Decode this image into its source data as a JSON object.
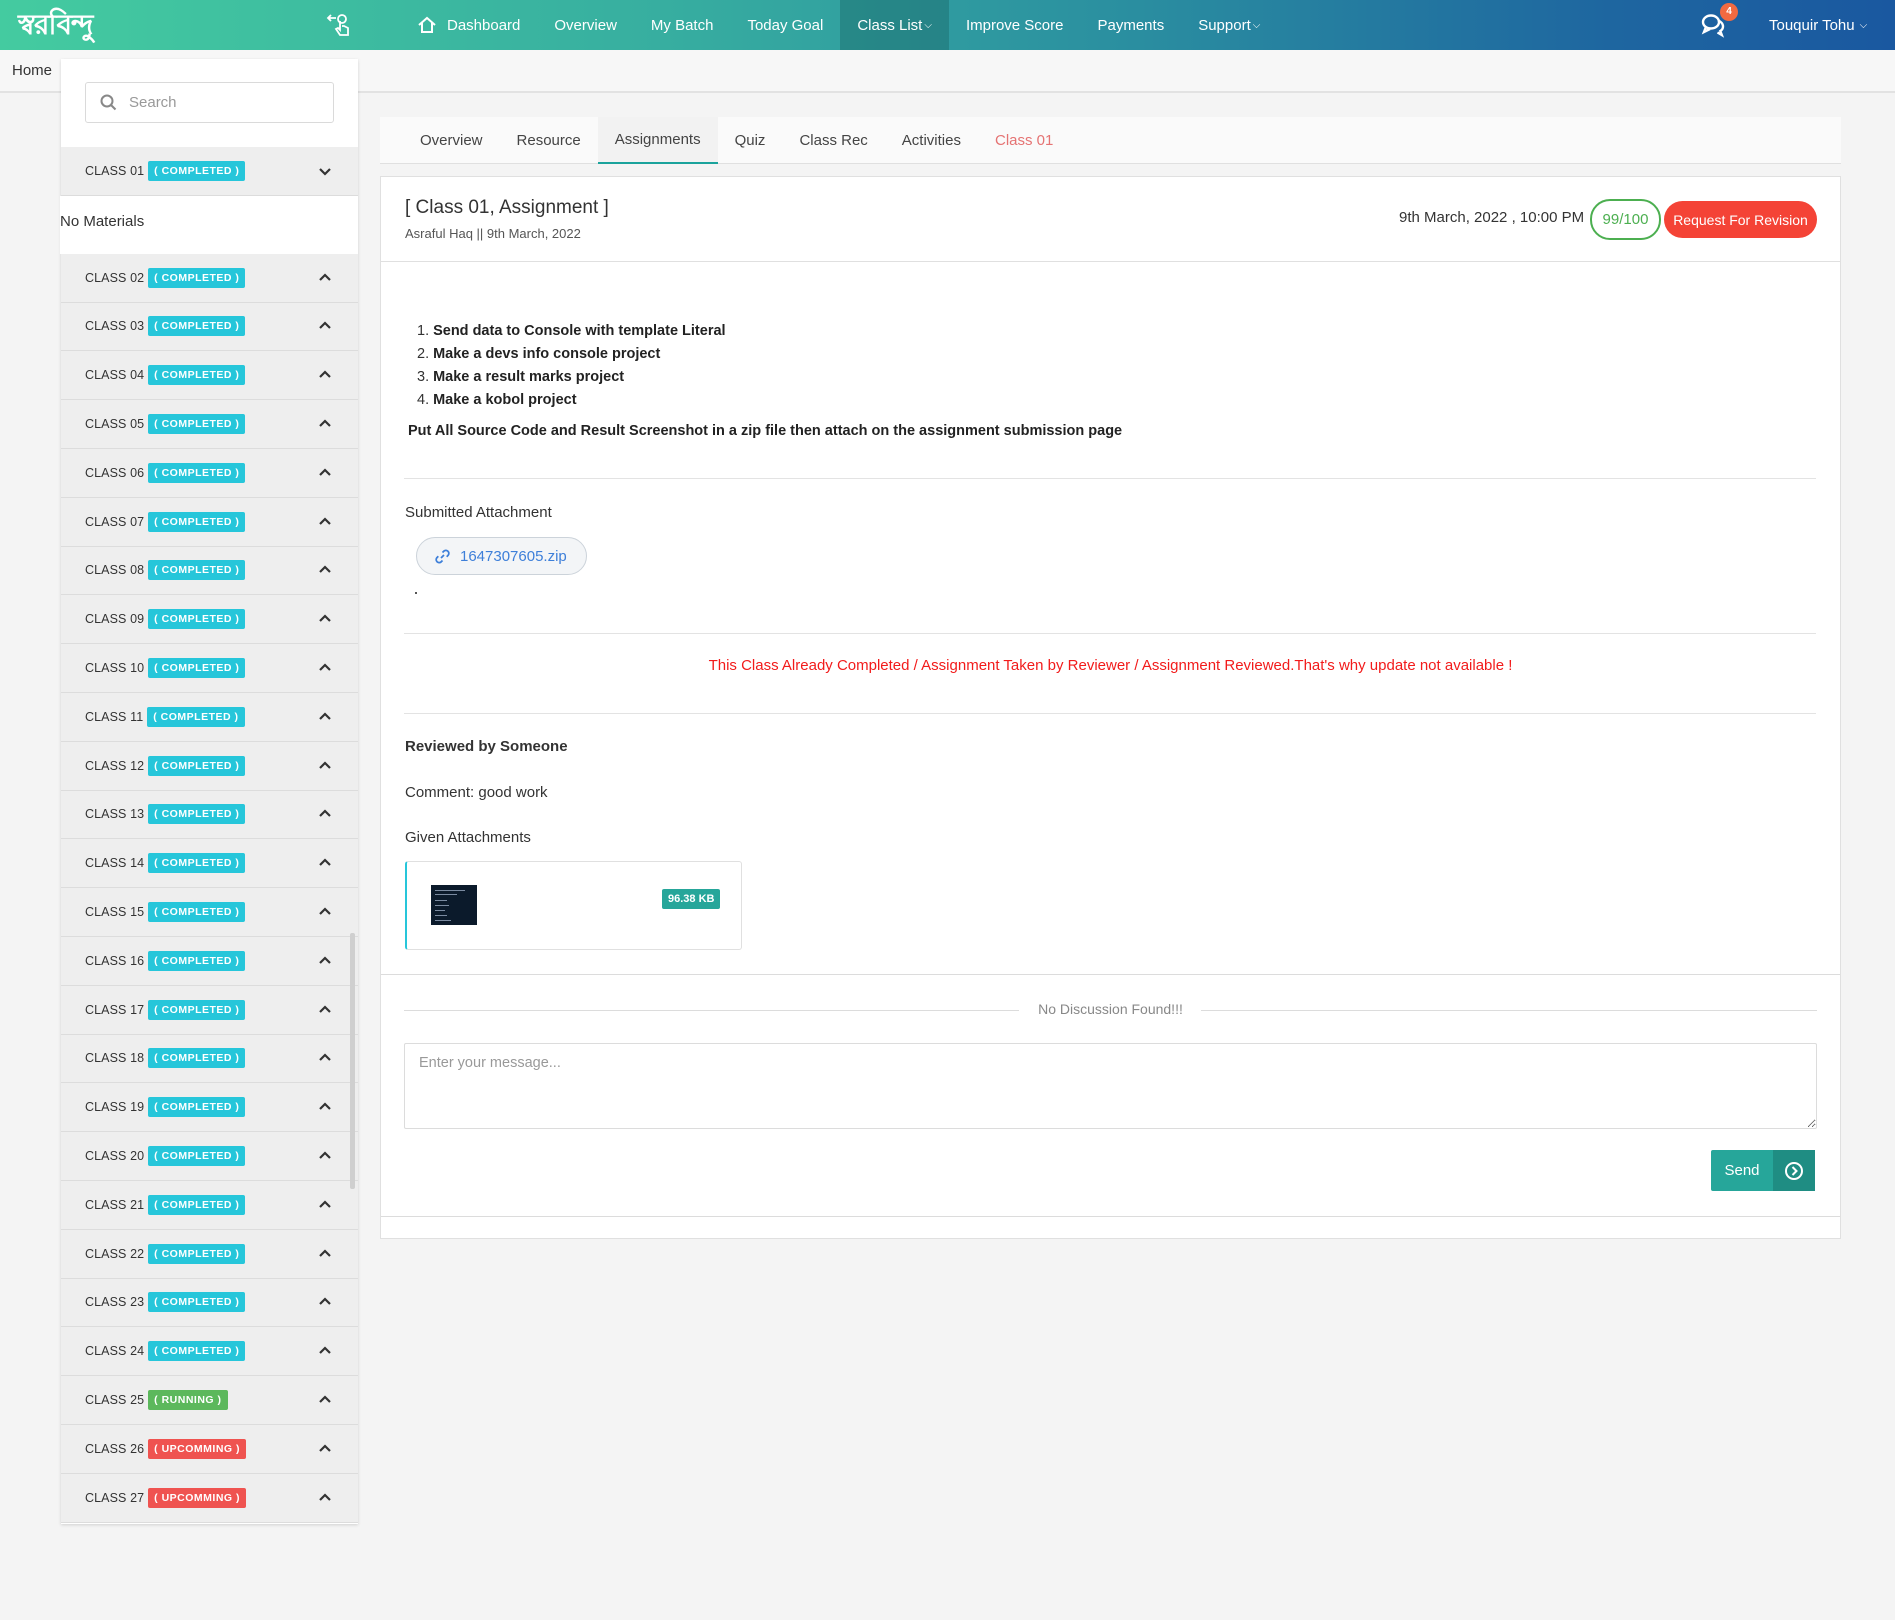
{
  "brand": {
    "logo_text": "স্বরবিন্দু"
  },
  "nav": {
    "items": [
      {
        "label": "Dashboard",
        "icon": "home-icon"
      },
      {
        "label": "Overview"
      },
      {
        "label": "My Batch"
      },
      {
        "label": "Today Goal"
      },
      {
        "label": "Class List",
        "dropdown": true,
        "active": true
      },
      {
        "label": "Improve Score"
      },
      {
        "label": "Payments"
      },
      {
        "label": "Support",
        "dropdown": true
      }
    ],
    "chevron": "⌄",
    "notifications": {
      "icon": "chat-icon",
      "count": "4"
    },
    "user": {
      "name": "Touquir Tohu",
      "chevron": "⌄"
    }
  },
  "breadcrumb": {
    "home": "Home"
  },
  "sidebar": {
    "search_placeholder": "Search",
    "no_materials": "No Materials",
    "classes": [
      {
        "name": "CLASS 01",
        "status": "( COMPLETED )",
        "type": "completed",
        "expanded": true
      },
      {
        "name": "CLASS 02",
        "status": "( COMPLETED )",
        "type": "completed"
      },
      {
        "name": "CLASS 03",
        "status": "( COMPLETED )",
        "type": "completed"
      },
      {
        "name": "CLASS 04",
        "status": "( COMPLETED )",
        "type": "completed"
      },
      {
        "name": "CLASS 05",
        "status": "( COMPLETED )",
        "type": "completed"
      },
      {
        "name": "CLASS 06",
        "status": "( COMPLETED )",
        "type": "completed"
      },
      {
        "name": "CLASS 07",
        "status": "( COMPLETED )",
        "type": "completed"
      },
      {
        "name": "CLASS 08",
        "status": "( COMPLETED )",
        "type": "completed"
      },
      {
        "name": "CLASS 09",
        "status": "( COMPLETED )",
        "type": "completed"
      },
      {
        "name": "CLASS 10",
        "status": "( COMPLETED )",
        "type": "completed"
      },
      {
        "name": "CLASS 11",
        "status": "( COMPLETED )",
        "type": "completed"
      },
      {
        "name": "CLASS 12",
        "status": "( COMPLETED )",
        "type": "completed"
      },
      {
        "name": "CLASS 13",
        "status": "( COMPLETED )",
        "type": "completed"
      },
      {
        "name": "CLASS 14",
        "status": "( COMPLETED )",
        "type": "completed"
      },
      {
        "name": "CLASS 15",
        "status": "( COMPLETED )",
        "type": "completed"
      },
      {
        "name": "CLASS 16",
        "status": "( COMPLETED )",
        "type": "completed"
      },
      {
        "name": "CLASS 17",
        "status": "( COMPLETED )",
        "type": "completed"
      },
      {
        "name": "CLASS 18",
        "status": "( COMPLETED )",
        "type": "completed"
      },
      {
        "name": "CLASS 19",
        "status": "( COMPLETED )",
        "type": "completed"
      },
      {
        "name": "CLASS 20",
        "status": "( COMPLETED )",
        "type": "completed"
      },
      {
        "name": "CLASS 21",
        "status": "( COMPLETED )",
        "type": "completed"
      },
      {
        "name": "CLASS 22",
        "status": "( COMPLETED )",
        "type": "completed"
      },
      {
        "name": "CLASS 23",
        "status": "( COMPLETED )",
        "type": "completed"
      },
      {
        "name": "CLASS 24",
        "status": "( COMPLETED )",
        "type": "completed"
      },
      {
        "name": "CLASS 25",
        "status": "( RUNNING )",
        "type": "running"
      },
      {
        "name": "CLASS 26",
        "status": "( UPCOMMING )",
        "type": "upcomming"
      },
      {
        "name": "CLASS 27",
        "status": "( UPCOMMING )",
        "type": "upcomming"
      }
    ]
  },
  "tabs": [
    {
      "label": "Overview"
    },
    {
      "label": "Resource"
    },
    {
      "label": "Assignments",
      "active": true
    },
    {
      "label": "Quiz"
    },
    {
      "label": "Class Rec"
    },
    {
      "label": "Activities"
    },
    {
      "label": "Class 01",
      "highlight": true
    }
  ],
  "assignment": {
    "title": "[ Class 01, Assignment ]",
    "subtitle": "Asraful Haq || 9th March, 2022",
    "deadline": "9th March, 2022 , 10:00 PM",
    "score": "99/100",
    "revision_button": "Request For Revision",
    "tasks": [
      "Send data to Console with template Literal",
      "Make a devs info console project",
      "Make a result marks project",
      "Make a kobol project"
    ],
    "instruction": "Put All Source Code and Result Screenshot in a zip file then attach on the assignment submission page",
    "submitted_label": "Submitted Attachment",
    "submitted_file": "1647307605.zip",
    "dot": ".",
    "warning": "This Class Already Completed / Assignment Taken by Reviewer / Assignment Reviewed.That's why update not available !",
    "reviewed_by": "Reviewed by Someone",
    "comment": "Comment: good work",
    "given_label": "Given Attachments",
    "given_size": "96.38 KB"
  },
  "discussion": {
    "empty_text": "No Discussion Found!!!",
    "placeholder": "Enter your message...",
    "send_label": "Send"
  },
  "colors": {
    "accent": "#26a69a",
    "completed": "#26c6da",
    "running": "#5cb85c",
    "upcomming": "#ef5350",
    "danger": "#f44336",
    "score": "#4caf50"
  }
}
